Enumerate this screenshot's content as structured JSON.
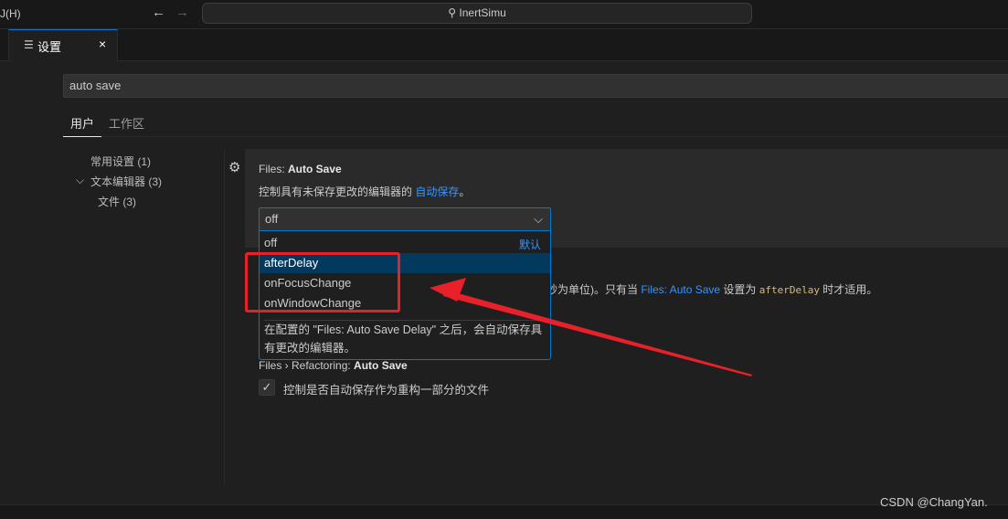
{
  "titlebar": {
    "menu_fragment": "J(H)",
    "search_text": "InertSimu",
    "search_icon": "search-icon"
  },
  "tab": {
    "label": "设置",
    "icon": "settings-list-icon",
    "close": "×"
  },
  "search": {
    "value": "auto save"
  },
  "scopes": [
    {
      "label": "用户",
      "active": true
    },
    {
      "label": "工作区",
      "active": false
    }
  ],
  "toc": [
    {
      "label": "常用设置 (1)"
    },
    {
      "label": "文本编辑器 (3)",
      "expanded": true
    },
    {
      "label": "文件 (3)"
    }
  ],
  "setting1": {
    "category": "Files: ",
    "name": "Auto Save",
    "desc_prefix": "控制具有未保存更改的编辑器的 ",
    "desc_link": "自动保存",
    "desc_suffix": "。",
    "value": "off",
    "options": [
      {
        "label": "off",
        "default_label": "默认"
      },
      {
        "label": "afterDelay",
        "selected": true
      },
      {
        "label": "onFocusChange"
      },
      {
        "label": "onWindowChange"
      }
    ],
    "option_desc": "在配置的 \"Files: Auto Save Delay\" 之后，会自动保存具有更改的编辑器。"
  },
  "setting2": {
    "desc_visible": "秒为单位)。只有当 ",
    "link": "Files: Auto Save",
    "mid": " 设置为 ",
    "code": "afterDelay",
    "end": " 时才适用。"
  },
  "setting3": {
    "category": "Files › Refactoring: ",
    "name": "Auto Save",
    "checked": true,
    "desc": "控制是否自动保存作为重构一部分的文件"
  },
  "annotation": {
    "color": "#e8202a"
  },
  "watermark": "CSDN @ChangYan."
}
